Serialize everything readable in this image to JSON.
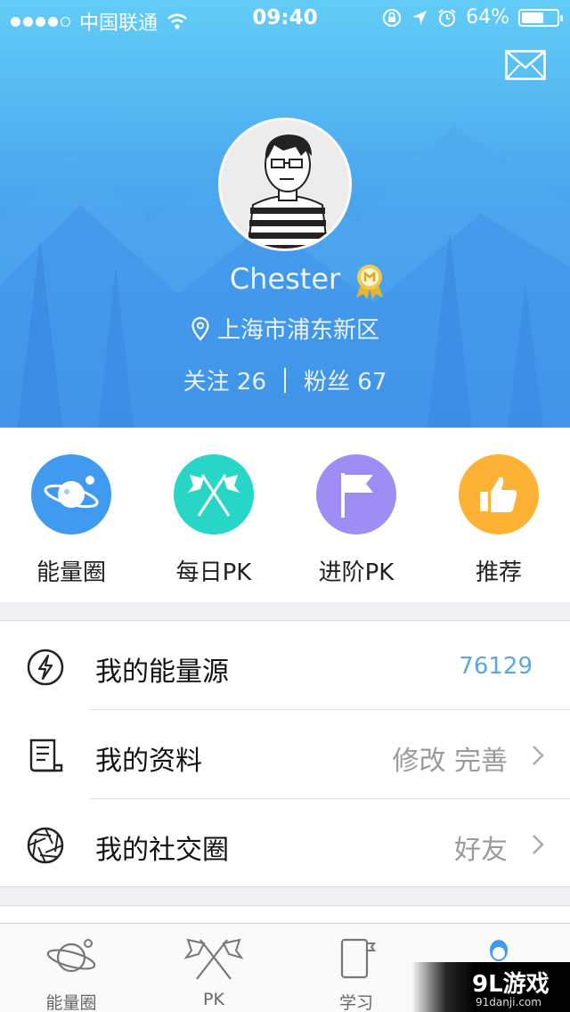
{
  "status_bar": {
    "carrier": "中国联通",
    "time": "09:40",
    "battery": "64%",
    "battery_level": 0.64
  },
  "profile": {
    "username": "Chester",
    "location": "上海市浦东新区",
    "following_label": "关注",
    "following_count": "26",
    "fans_label": "粉丝",
    "fans_count": "67"
  },
  "quick_actions": [
    {
      "label": "能量圈",
      "color": "#3f9af0"
    },
    {
      "label": "每日PK",
      "color": "#27d6c7"
    },
    {
      "label": "进阶PK",
      "color": "#9f8cf5"
    },
    {
      "label": "推荐",
      "color": "#fdb236"
    }
  ],
  "menu": [
    {
      "label": "我的能量源",
      "value": "76129",
      "icon": "lightning-icon"
    },
    {
      "label": "我的资料",
      "value": "修改 完善",
      "icon": "document-icon"
    },
    {
      "label": "我的社交圈",
      "value": "好友",
      "icon": "aperture-icon"
    }
  ],
  "tabs": [
    {
      "label": "能量圈",
      "icon": "planet-icon"
    },
    {
      "label": "PK",
      "icon": "crossed-flags-icon"
    },
    {
      "label": "学习",
      "icon": "notebook-icon"
    },
    {
      "label": "",
      "icon": "user-icon"
    }
  ],
  "watermark": {
    "brand": "9L游戏",
    "site": "91danji.com"
  },
  "colors": {
    "header_top": "#62cdf7",
    "header_bottom": "#3b86e7",
    "accent_value": "#58a8e6"
  }
}
